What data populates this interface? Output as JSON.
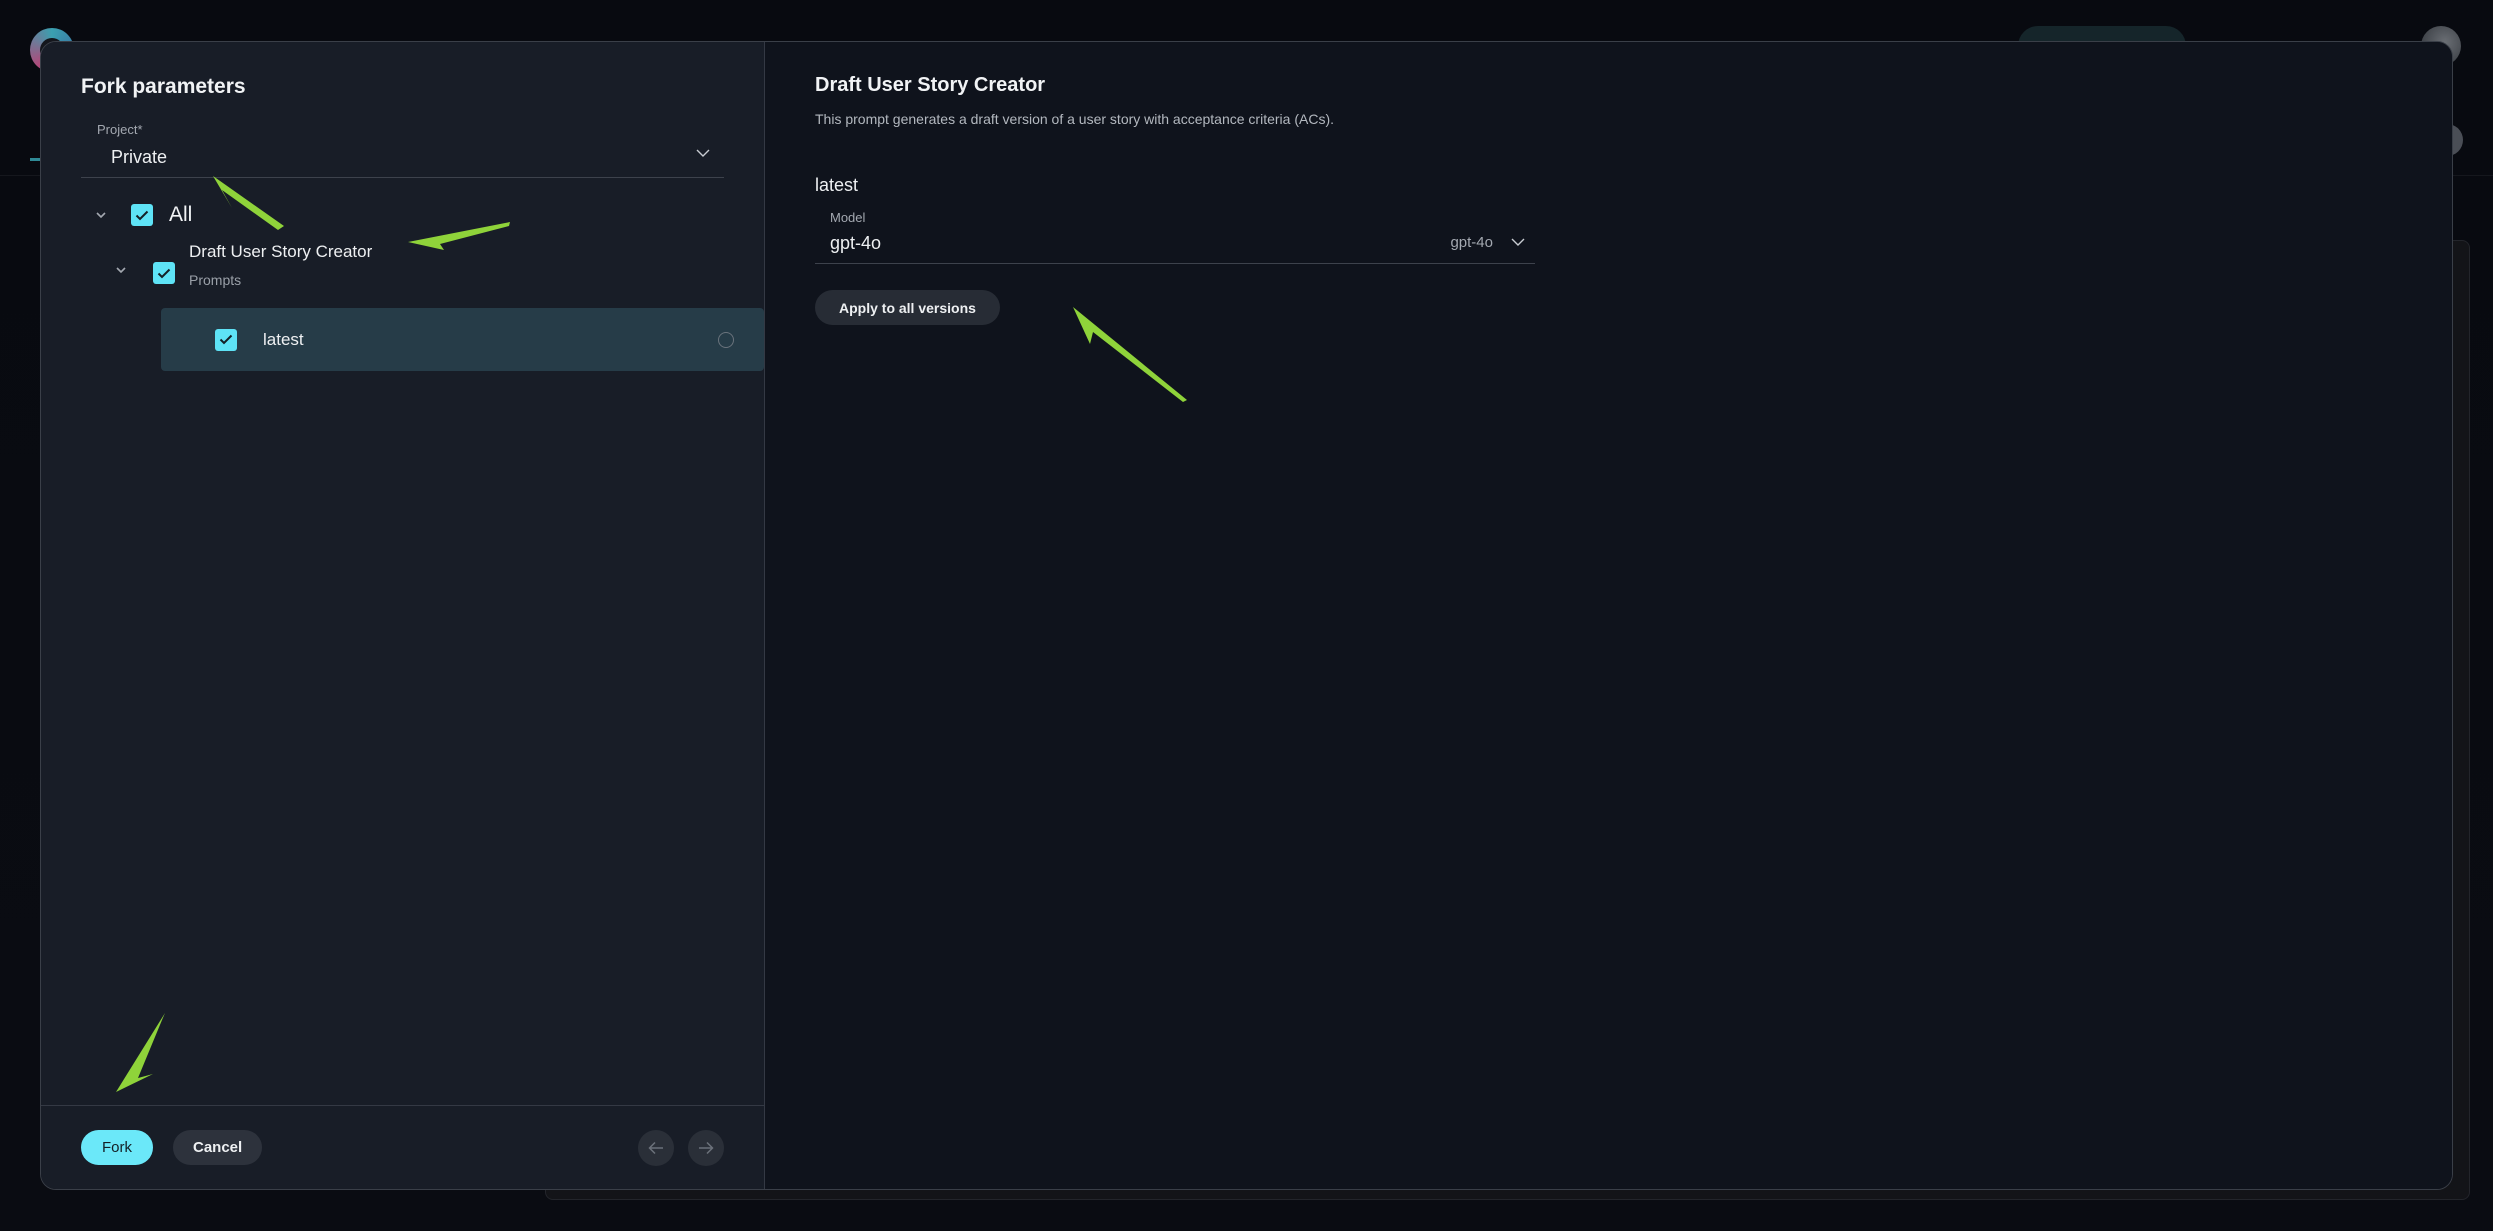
{
  "modal": {
    "title": "Fork parameters",
    "project_field": {
      "label": "Project*",
      "value": "Private"
    },
    "tree": {
      "all_label": "All",
      "all_checked": true,
      "prompt": {
        "name": "Draft User Story Creator",
        "type": "Prompts",
        "checked": true
      },
      "versions": [
        {
          "name": "latest",
          "checked": true,
          "selected": true
        }
      ]
    },
    "footer": {
      "fork_label": "Fork",
      "cancel_label": "Cancel",
      "prev_icon": "arrow-left-icon",
      "next_icon": "arrow-right-icon"
    }
  },
  "details": {
    "title": "Draft User Story Creator",
    "description": "This prompt generates a draft version of a user story with acceptance criteria (ACs).",
    "version_title": "latest",
    "model_field": {
      "label": "Model",
      "value": "gpt-4o",
      "selected_option": "gpt-4o"
    },
    "apply_label": "Apply to all versions"
  },
  "colors": {
    "accent": "#6be8f9",
    "checkbox": "#5ee3f6",
    "selected_row": "#263c48",
    "annotation_arrow": "#8fd33a"
  }
}
